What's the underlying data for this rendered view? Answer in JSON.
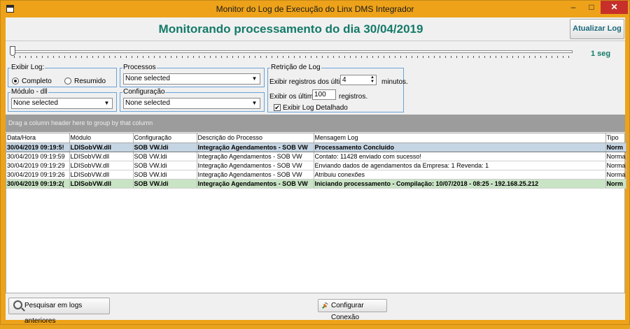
{
  "window": {
    "title": "Monitor do Log de Execução do Linx DMS Integrador",
    "minimize": "–",
    "maximize": "□",
    "close": "✕"
  },
  "header": {
    "title": "Monitorando processamento do dia 30/04/2019",
    "refresh_button": "Atualizar Log"
  },
  "slider": {
    "label": "1 seg",
    "value_fraction": 0.0
  },
  "exibir_log": {
    "legend": "Exibir Log:",
    "options": [
      "Completo",
      "Resumido"
    ],
    "selected": "Completo"
  },
  "modulo": {
    "legend": "Módulo - dll",
    "value": "None selected"
  },
  "processos": {
    "legend": "Processos",
    "value": "None selected"
  },
  "configuracao": {
    "legend": "Configuração",
    "value": "None selected"
  },
  "retencao": {
    "legend": "Retrição de Log",
    "registros_prefix": "Exibir registros dos últimos",
    "registros_value": "4",
    "registros_suffix": "minutos.",
    "ultimos_prefix": "Exibir os últimos",
    "ultimos_value": "100",
    "ultimos_suffix": "registros.",
    "detalhado_label": "Exibir Log Detalhado",
    "detalhado_checked": true
  },
  "group_bar": "Drag a column header here to group by that column",
  "grid": {
    "columns": [
      "Data/Hora",
      "Módulo",
      "Configuração",
      "Descrição do Processo",
      "Mensagem Log",
      "Tipo"
    ],
    "rows": [
      {
        "style": "selected",
        "cells": [
          "30/04/2019 09:19:5!",
          "LDISobVW.dll",
          "SOB VW.ldi",
          "Integração Agendamentos - SOB VW",
          "Processamento Concluído",
          "Norm"
        ]
      },
      {
        "style": "normal",
        "cells": [
          "30/04/2019 09:19:59",
          "LDISobVW.dll",
          "SOB VW.ldi",
          "Integração Agendamentos - SOB VW",
          "Contato: 11428 enviado com sucesso!",
          "Norma"
        ]
      },
      {
        "style": "normal",
        "cells": [
          "30/04/2019 09:19:29",
          "LDISobVW.dll",
          "SOB VW.ldi",
          "Integração Agendamentos - SOB VW",
          "Enviando dados de agendamentos da Empresa: 1 Revenda: 1",
          "Norma"
        ]
      },
      {
        "style": "normal",
        "cells": [
          "30/04/2019 09:19:26",
          "LDISobVW.dll",
          "SOB VW.ldi",
          "Integração Agendamentos - SOB VW",
          "Atribuiu conexões",
          "Norma"
        ]
      },
      {
        "style": "green",
        "cells": [
          "30/04/2019 09:19:2(",
          "LDISobVW.dll",
          "SOB VW.ldi",
          "Integração Agendamentos - SOB VW",
          "Iniciando processamento - Compilação: 10/07/2018 - 08:25 - 192.168.25.212",
          "Norm"
        ]
      }
    ]
  },
  "footer": {
    "search_button": "Pesquisar em logs anteriores",
    "conn_button": "Configurar Conexão"
  },
  "colors": {
    "accent": "#157a69",
    "window_frame": "#eda21a",
    "group_border": "#6aa2d8",
    "selected_row": "#c5d5e3",
    "green_row": "#c9e3c5"
  },
  "icons": {
    "search": "magnifier-icon",
    "connection": "plug-icon",
    "app": "app-window-icon"
  }
}
